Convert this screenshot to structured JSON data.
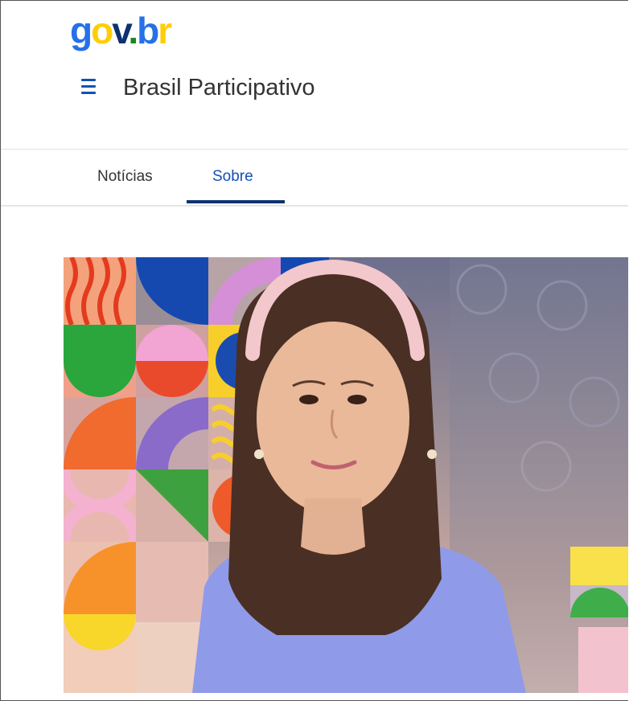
{
  "header": {
    "logo": {
      "g": "g",
      "o": "o",
      "v": "v",
      "dot": ".",
      "b": "b",
      "r": "r"
    },
    "site_title": "Brasil Participativo",
    "menu_icon": "hamburger-menu-icon"
  },
  "tabs": [
    {
      "label": "Notícias",
      "active": false
    },
    {
      "label": "Sobre",
      "active": true
    }
  ],
  "colors": {
    "primary_blue": "#1351b4",
    "dark_blue": "#0c326f",
    "logo_yellow": "#ffcd07",
    "logo_green": "#168821"
  },
  "hero": {
    "description": "banner-image"
  }
}
